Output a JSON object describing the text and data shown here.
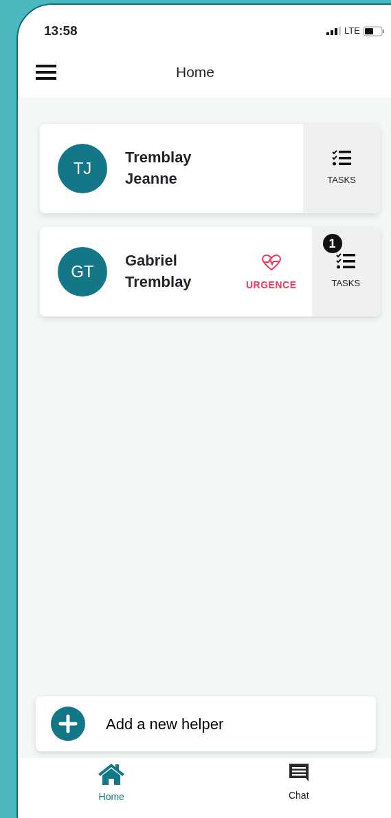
{
  "status_bar": {
    "time": "13:58",
    "network": "LTE"
  },
  "header": {
    "title": "Home"
  },
  "helpers": [
    {
      "initials": "TJ",
      "name": "Tremblay Jeanne",
      "urgent": false,
      "tasks_label": "TASKS"
    },
    {
      "initials": "GT",
      "name": "Gabriel Tremblay",
      "urgent": true,
      "urgent_label": "URGENCE",
      "tasks_badge": "1",
      "tasks_label": "TASKS"
    }
  ],
  "add_helper": {
    "label": "Add a new helper"
  },
  "tabs": [
    {
      "label": "Home",
      "kind": "home",
      "selected": true
    },
    {
      "label": "Chat",
      "kind": "chat",
      "selected": false
    }
  ]
}
